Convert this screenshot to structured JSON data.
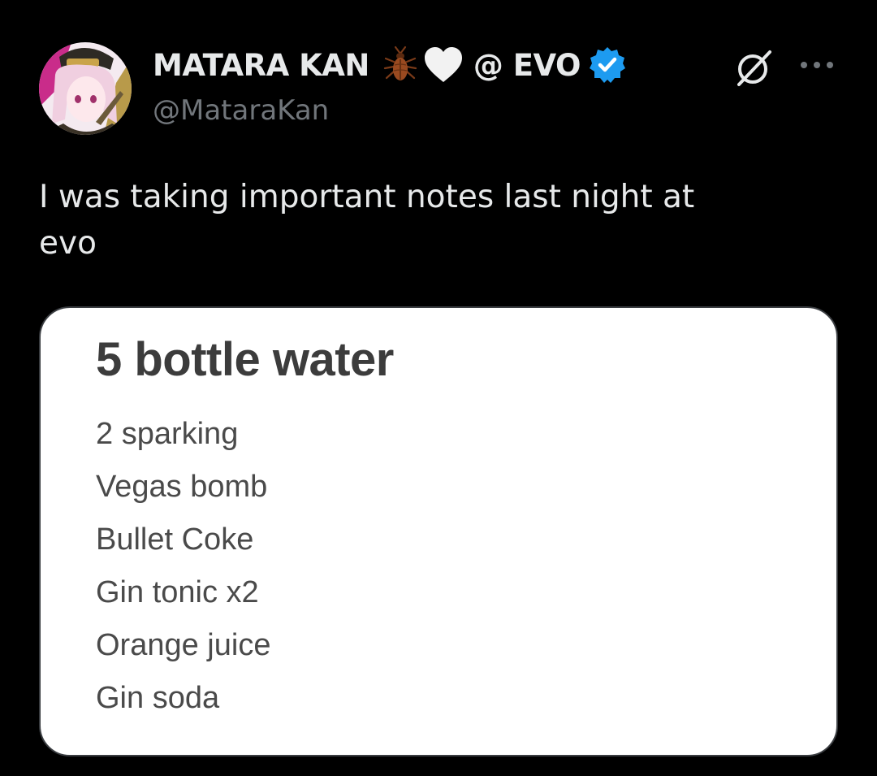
{
  "tweet": {
    "author": {
      "display_name_main": "MATARA KAN",
      "display_name_suffix": "@ EVO",
      "handle": "@MataraKan",
      "name_emojis": [
        "cockroach-icon",
        "white-heart-icon"
      ],
      "verified": true,
      "verified_color": "#1d9bf0"
    },
    "text_line1": "I was taking important notes last night at",
    "text_line2": "evo",
    "header_icons": [
      "grok-slash-circle-icon",
      "more-options-icon"
    ],
    "media": {
      "note_title": "5 bottle water",
      "note_items": [
        "2 sparking",
        "Vegas bomb",
        "Bullet Coke",
        "Gin tonic x2",
        "Orange juice",
        "Gin soda"
      ]
    }
  },
  "colors": {
    "background": "#000000",
    "primary_text": "#e7e9ea",
    "secondary_text": "#71767b",
    "note_background": "#ffffff",
    "note_title": "#3c3c3c",
    "note_text": "#4a4a4a"
  }
}
